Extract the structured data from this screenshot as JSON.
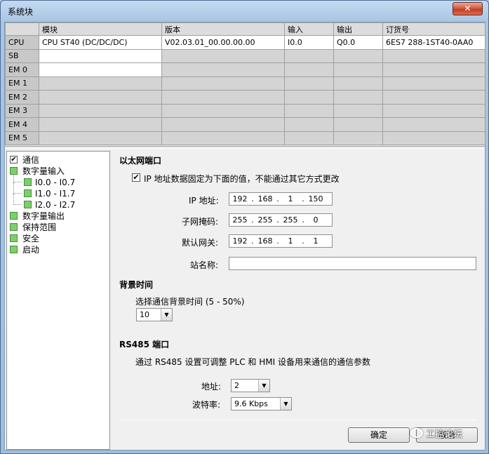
{
  "window": {
    "title": "系统块",
    "close_glyph": "✕"
  },
  "grid": {
    "headers": [
      "",
      "模块",
      "版本",
      "输入",
      "输出",
      "订货号"
    ],
    "rows": [
      {
        "slot": "CPU",
        "module": "CPU ST40 (DC/DC/DC)",
        "version": "V02.03.01_00.00.00.00",
        "input": "I0.0",
        "output": "Q0.0",
        "order": "6ES7 288-1ST40-0AA0"
      },
      {
        "slot": "SB",
        "module": "",
        "version": "",
        "input": "",
        "output": "",
        "order": ""
      },
      {
        "slot": "EM 0",
        "module": "",
        "version": "",
        "input": "",
        "output": "",
        "order": ""
      },
      {
        "slot": "EM 1",
        "module": "",
        "version": "",
        "input": "",
        "output": "",
        "order": ""
      },
      {
        "slot": "EM 2",
        "module": "",
        "version": "",
        "input": "",
        "output": "",
        "order": ""
      },
      {
        "slot": "EM 3",
        "module": "",
        "version": "",
        "input": "",
        "output": "",
        "order": ""
      },
      {
        "slot": "EM 4",
        "module": "",
        "version": "",
        "input": "",
        "output": "",
        "order": ""
      },
      {
        "slot": "EM 5",
        "module": "",
        "version": "",
        "input": "",
        "output": "",
        "order": ""
      }
    ]
  },
  "tree": {
    "items": [
      {
        "label": "通信",
        "checked": true
      },
      {
        "label": "数字量输入"
      },
      {
        "label": "I0.0 - I0.7"
      },
      {
        "label": "I1.0 - I1.7"
      },
      {
        "label": "I2.0 - I2.7"
      },
      {
        "label": "数字量输出"
      },
      {
        "label": "保持范围"
      },
      {
        "label": "安全"
      },
      {
        "label": "启动"
      }
    ]
  },
  "ethernet": {
    "title": "以太网端口",
    "fixed_ip_label": "IP 地址数据固定为下面的值，不能通过其它方式更改",
    "fixed_ip_checked": true,
    "ip_label": "IP 地址:",
    "ip": [
      "192",
      "168",
      "1",
      "150"
    ],
    "mask_label": "子网掩码:",
    "mask": [
      "255",
      "255",
      "255",
      "0"
    ],
    "gateway_label": "默认网关:",
    "gateway": [
      "192",
      "168",
      "1",
      "1"
    ],
    "station_label": "站名称:",
    "station_value": ""
  },
  "background": {
    "title": "背景时间",
    "select_label": "选择通信背景时间 (5 - 50%)",
    "value": "10"
  },
  "rs485": {
    "title": "RS485 端口",
    "desc": "通过 RS485 设置可调整 PLC 和 HMI 设备用来通信的通信参数",
    "address_label": "地址:",
    "address_value": "2",
    "baud_label": "波特率:",
    "baud_value": "9.6 Kbps"
  },
  "buttons": {
    "ok": "确定",
    "cancel": "取消"
  },
  "watermark": "工控论坛"
}
